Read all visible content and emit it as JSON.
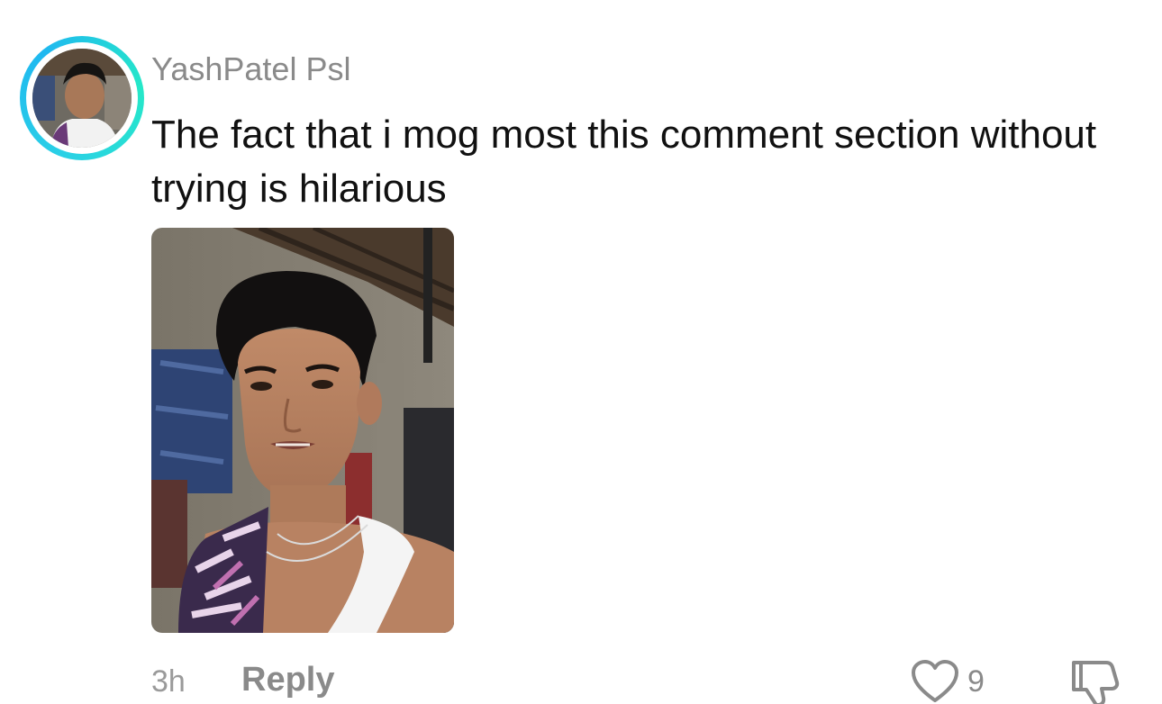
{
  "comment": {
    "username": "YashPatel Psl",
    "text": "The fact that i mog most this comment section without trying is hilarious",
    "timestamp": "3h",
    "reply_label": "Reply",
    "like_count": "9",
    "icons": {
      "like": "heart-outline-icon",
      "dislike": "thumbs-down-outline-icon"
    },
    "colors": {
      "ring_start": "#2ad0e6",
      "ring_end": "#25e8c8",
      "meta_text": "#8a8a8a",
      "body_text": "#111111"
    }
  }
}
